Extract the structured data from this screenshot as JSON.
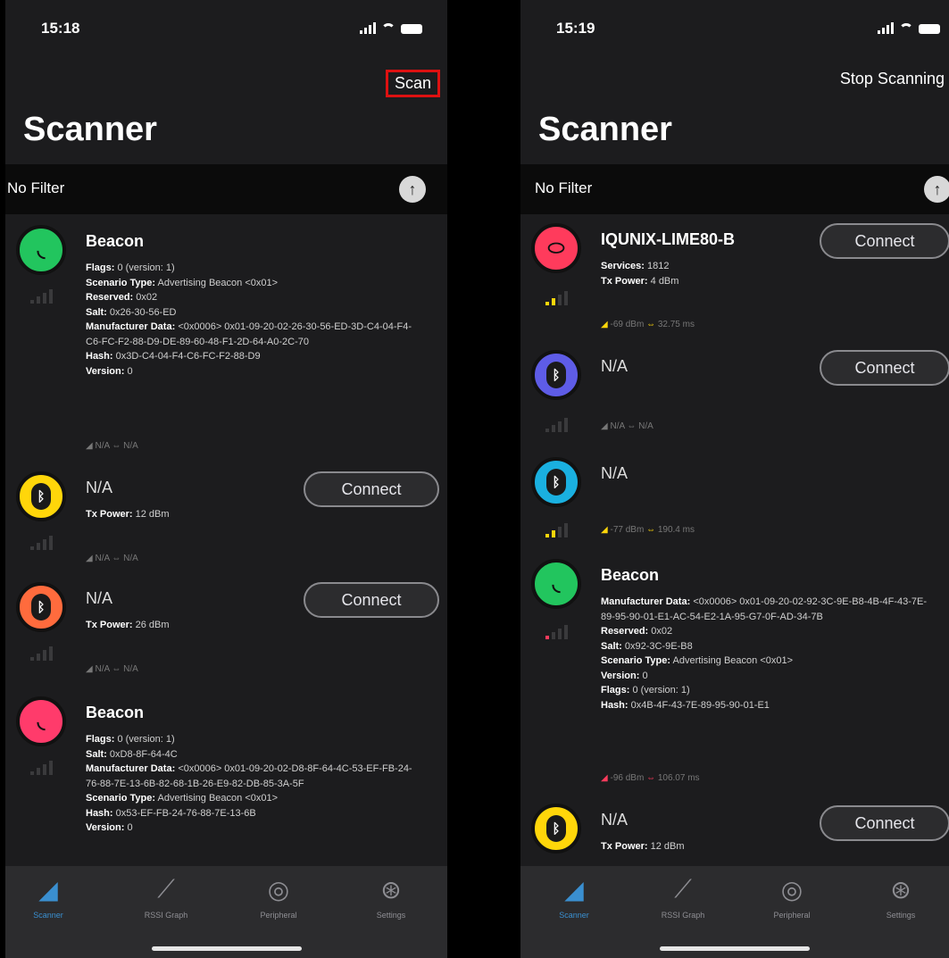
{
  "left": {
    "status_time": "15:18",
    "nav_action": "Scan",
    "title": "Scanner",
    "filter_label": "No Filter",
    "devices": [
      {
        "name": "Beacon",
        "details": [
          {
            "k": "Flags:",
            "v": "0 (version: 1)"
          },
          {
            "k": "Scenario Type:",
            "v": "Advertising Beacon <0x01>"
          },
          {
            "k": "Reserved:",
            "v": "0x02"
          },
          {
            "k": "Salt:",
            "v": "0x26-30-56-ED"
          },
          {
            "k": "Manufacturer Data:",
            "v": "<0x0006> 0x01-09-20-02-26-30-56-ED-3D-C4-04-F4-C6-FC-F2-88-D9-DE-89-60-48-F1-2D-64-A0-2C-70"
          },
          {
            "k": "Hash:",
            "v": "0x3D-C4-04-F4-C6-FC-F2-88-D9"
          },
          {
            "k": "Version:",
            "v": "0"
          }
        ],
        "rssi": "N/A",
        "interval": "N/A"
      },
      {
        "name": "N/A",
        "details": [
          {
            "k": "Tx Power:",
            "v": "12 dBm"
          }
        ],
        "rssi": "N/A",
        "interval": "N/A",
        "connect_label": "Connect"
      },
      {
        "name": "N/A",
        "details": [
          {
            "k": "Tx Power:",
            "v": "26 dBm"
          }
        ],
        "rssi": "N/A",
        "interval": "N/A",
        "connect_label": "Connect"
      },
      {
        "name": "Beacon",
        "details": [
          {
            "k": "Flags:",
            "v": "0 (version: 1)"
          },
          {
            "k": "Salt:",
            "v": "0xD8-8F-64-4C"
          },
          {
            "k": "Manufacturer Data:",
            "v": "<0x0006> 0x01-09-20-02-D8-8F-64-4C-53-EF-FB-24-76-88-7E-13-6B-82-68-1B-26-E9-82-DB-85-3A-5F"
          },
          {
            "k": "Scenario Type:",
            "v": "Advertising Beacon <0x01>"
          },
          {
            "k": "Hash:",
            "v": "0x53-EF-FB-24-76-88-7E-13-6B"
          },
          {
            "k": "Version:",
            "v": "0"
          }
        ]
      }
    ]
  },
  "right": {
    "status_time": "15:19",
    "nav_action": "Stop Scanning",
    "title": "Scanner",
    "filter_label": "No Filter",
    "devices": [
      {
        "name": "IQUNIX-LIME80-B",
        "details": [
          {
            "k": "Services:",
            "v": "1812"
          },
          {
            "k": "Tx Power:",
            "v": "4 dBm"
          }
        ],
        "rssi": "-69 dBm",
        "interval": "32.75 ms",
        "connect_label": "Connect"
      },
      {
        "name": "N/A",
        "details": [],
        "rssi": "N/A",
        "interval": "N/A",
        "connect_label": "Connect"
      },
      {
        "name": "N/A",
        "details": [],
        "rssi": "-77 dBm",
        "interval": "190.4 ms"
      },
      {
        "name": "Beacon",
        "details": [
          {
            "k": "Manufacturer Data:",
            "v": "<0x0006> 0x01-09-20-02-92-3C-9E-B8-4B-4F-43-7E-89-95-90-01-E1-AC-54-E2-1A-95-G7-0F-AD-34-7B"
          },
          {
            "k": "Reserved:",
            "v": "0x02"
          },
          {
            "k": "Salt:",
            "v": "0x92-3C-9E-B8"
          },
          {
            "k": "Scenario Type:",
            "v": "Advertising Beacon <0x01>"
          },
          {
            "k": "Version:",
            "v": "0"
          },
          {
            "k": "Flags:",
            "v": "0 (version: 1)"
          },
          {
            "k": "Hash:",
            "v": "0x4B-4F-43-7E-89-95-90-01-E1"
          }
        ],
        "rssi": "-96 dBm",
        "interval": "106.07 ms"
      },
      {
        "name": "N/A",
        "details": [
          {
            "k": "Tx Power:",
            "v": "12 dBm"
          }
        ],
        "connect_label": "Connect"
      }
    ]
  },
  "tabs": [
    {
      "label": "Scanner",
      "icon": "scanner-icon"
    },
    {
      "label": "RSSI Graph",
      "icon": "graph-icon"
    },
    {
      "label": "Peripheral",
      "icon": "peripheral-icon"
    },
    {
      "label": "Settings",
      "icon": "settings-icon"
    }
  ],
  "colors": {
    "beacon_green": "#22c55e",
    "beacon_pink": "#ff3b6b",
    "bt_yellow": "#ffd60a",
    "bt_orange": "#ff6b3d",
    "bt_purple": "#5e5ce6",
    "bt_cyan": "#1ab0e0",
    "iqunix_red": "#ff3b5c",
    "tab_active": "#3a8fd0"
  }
}
